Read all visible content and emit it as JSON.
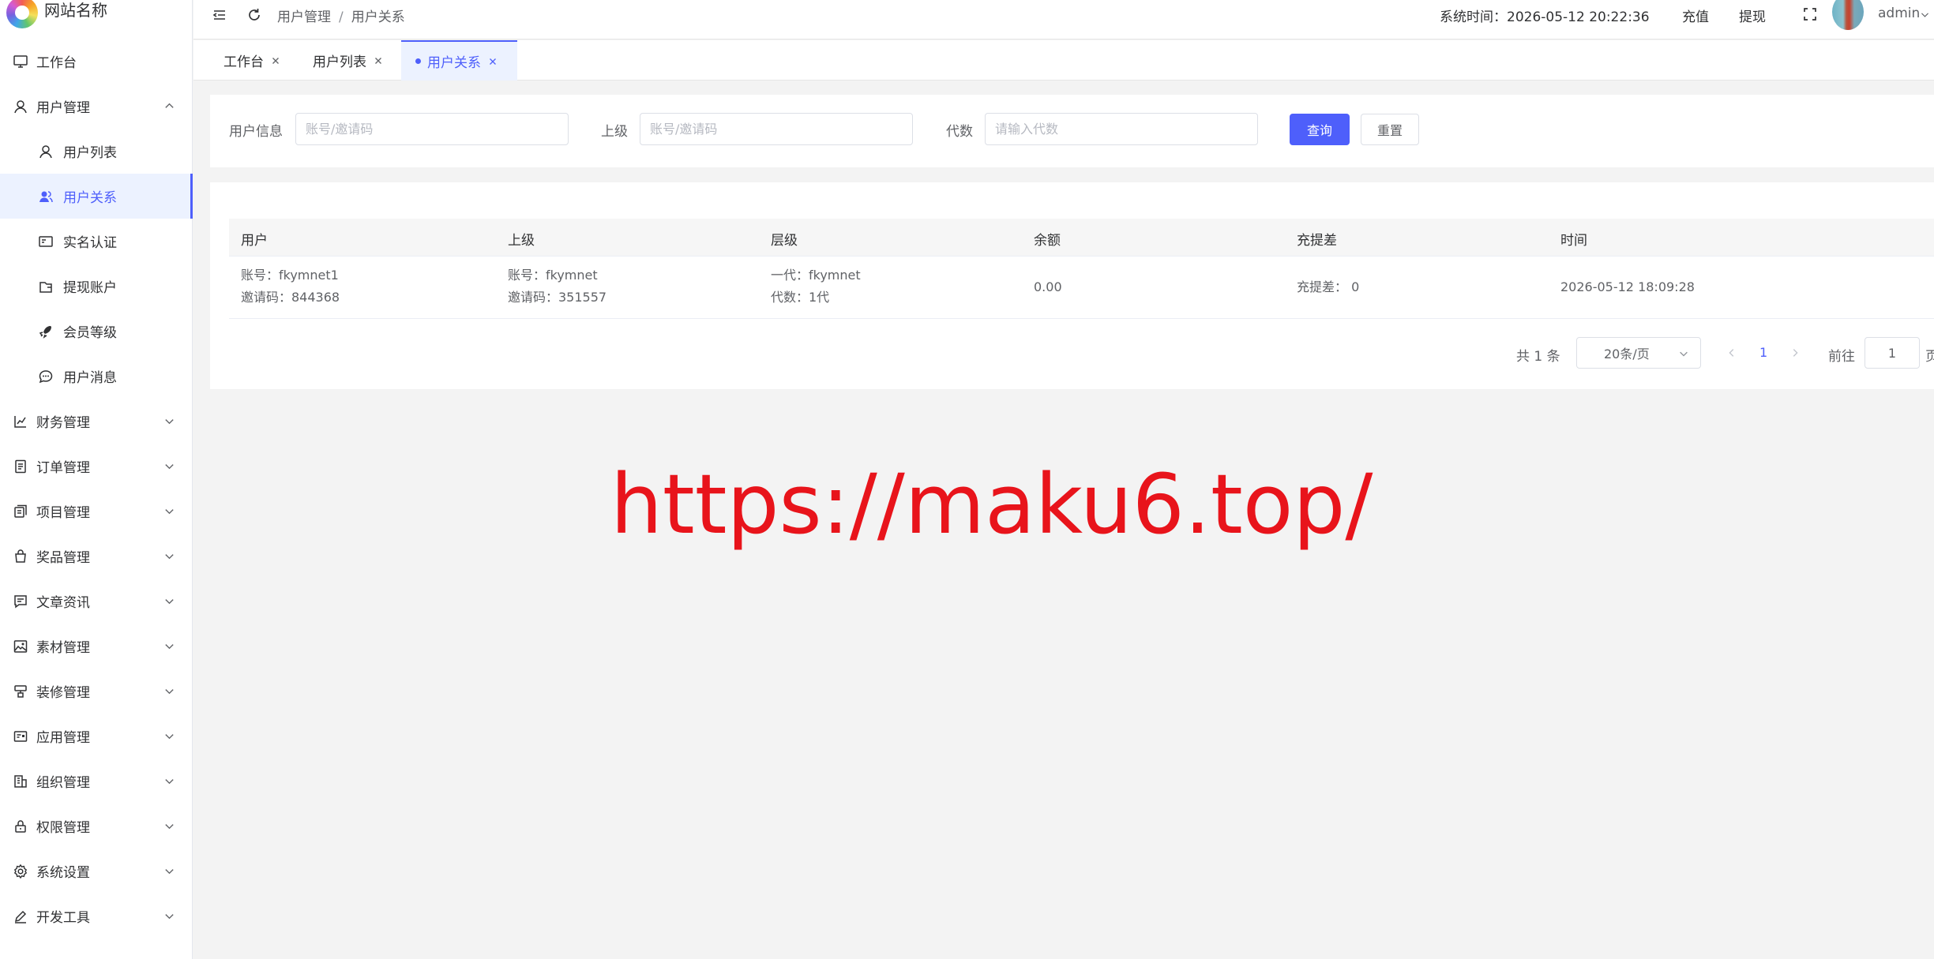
{
  "brand": {
    "name": "网站名称"
  },
  "sidebar": {
    "items": [
      {
        "label": "工作台",
        "icon": "monitor-icon"
      },
      {
        "label": "用户管理",
        "icon": "user-icon",
        "expanded": true
      },
      {
        "label": "用户列表",
        "icon": "user-outline-icon",
        "sub": true
      },
      {
        "label": "用户关系",
        "icon": "users-icon",
        "sub": true,
        "active": true
      },
      {
        "label": "实名认证",
        "icon": "id-card-icon",
        "sub": true
      },
      {
        "label": "提现账户",
        "icon": "wallet-icon",
        "sub": true
      },
      {
        "label": "会员等级",
        "icon": "rocket-icon",
        "sub": true
      },
      {
        "label": "用户消息",
        "icon": "chat-icon",
        "sub": true
      },
      {
        "label": "财务管理",
        "icon": "chart-icon"
      },
      {
        "label": "订单管理",
        "icon": "document-icon"
      },
      {
        "label": "项目管理",
        "icon": "copy-icon"
      },
      {
        "label": "奖品管理",
        "icon": "bag-icon"
      },
      {
        "label": "文章资讯",
        "icon": "message-icon"
      },
      {
        "label": "素材管理",
        "icon": "image-icon"
      },
      {
        "label": "装修管理",
        "icon": "brush-icon"
      },
      {
        "label": "应用管理",
        "icon": "app-icon"
      },
      {
        "label": "组织管理",
        "icon": "building-icon"
      },
      {
        "label": "权限管理",
        "icon": "lock-icon"
      },
      {
        "label": "系统设置",
        "icon": "gear-icon"
      },
      {
        "label": "开发工具",
        "icon": "edit-icon"
      }
    ]
  },
  "header": {
    "breadcrumb": [
      "用户管理",
      "用户关系"
    ],
    "breadcrumb_sep": "/",
    "system_time_label": "系统时间：",
    "system_time": "2026-05-12 20:22:36",
    "recharge": "充值",
    "withdraw": "提现",
    "username": "admin"
  },
  "tabs": [
    {
      "label": "工作台",
      "active": false
    },
    {
      "label": "用户列表",
      "active": false
    },
    {
      "label": "用户关系",
      "active": true
    }
  ],
  "search": {
    "user_info_label": "用户信息",
    "user_info_placeholder": "账号/邀请码",
    "parent_label": "上级",
    "parent_placeholder": "账号/邀请码",
    "gen_label": "代数",
    "gen_placeholder": "请输入代数",
    "query_btn": "查询",
    "reset_btn": "重置"
  },
  "table": {
    "columns": [
      "用户",
      "上级",
      "层级",
      "余额",
      "充提差",
      "时间"
    ],
    "rows": [
      {
        "user_line1": "账号：fkymnet1",
        "user_line2": "邀请码：844368",
        "parent_line1": "账号：fkymnet",
        "parent_line2": "邀请码：351557",
        "level_line1": "一代：fkymnet",
        "level_line2": "代数：1代",
        "balance": "0.00",
        "diff": "充提差： 0",
        "time": "2026-05-12 18:09:28"
      }
    ]
  },
  "pagination": {
    "total": "共 1 条",
    "page_size": "20条/页",
    "current": "1",
    "goto_label": "前往",
    "goto_value": "1",
    "page_suffix": "页"
  },
  "watermark": "https://maku6.top/",
  "colors": {
    "accent": "#4e5ffb",
    "watermark": "#e8141b"
  }
}
